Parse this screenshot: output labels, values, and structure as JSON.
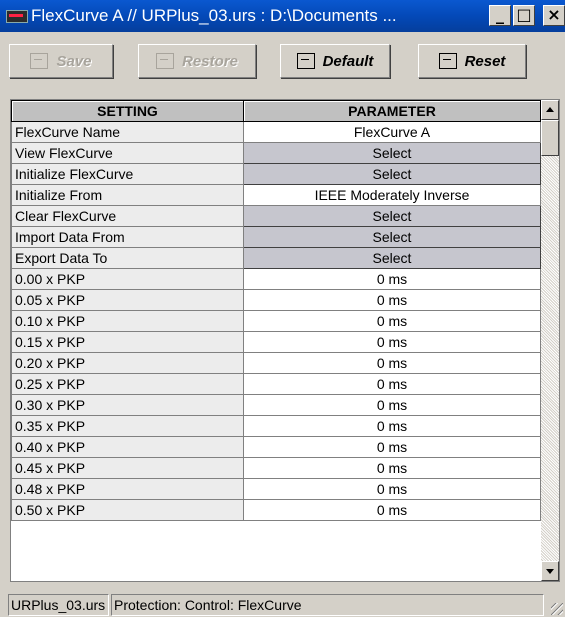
{
  "window": {
    "title": "FlexCurve A // URPlus_03.urs : D:\\Documents ...",
    "minimize": "_",
    "maximize": "□",
    "close": "×"
  },
  "toolbar": {
    "save": "Save",
    "restore": "Restore",
    "default": "Default",
    "reset": "Reset"
  },
  "grid": {
    "headers": [
      "SETTING",
      "PARAMETER"
    ],
    "rows": [
      {
        "setting": "FlexCurve Name",
        "parameter": "FlexCurve A",
        "type": "text"
      },
      {
        "setting": "View FlexCurve",
        "parameter": "Select",
        "type": "button"
      },
      {
        "setting": "Initialize FlexCurve",
        "parameter": "Select",
        "type": "button"
      },
      {
        "setting": "Initialize From",
        "parameter": "IEEE Moderately Inverse",
        "type": "text"
      },
      {
        "setting": "Clear FlexCurve",
        "parameter": "Select",
        "type": "button"
      },
      {
        "setting": "Import Data From",
        "parameter": "Select",
        "type": "button"
      },
      {
        "setting": "Export Data To",
        "parameter": "Select",
        "type": "button"
      },
      {
        "setting": "0.00 x PKP",
        "parameter": "0 ms",
        "type": "text"
      },
      {
        "setting": "0.05 x PKP",
        "parameter": "0 ms",
        "type": "text"
      },
      {
        "setting": "0.10 x PKP",
        "parameter": "0 ms",
        "type": "text"
      },
      {
        "setting": "0.15 x PKP",
        "parameter": "0 ms",
        "type": "text"
      },
      {
        "setting": "0.20 x PKP",
        "parameter": "0 ms",
        "type": "text"
      },
      {
        "setting": "0.25 x PKP",
        "parameter": "0 ms",
        "type": "text"
      },
      {
        "setting": "0.30 x PKP",
        "parameter": "0 ms",
        "type": "text"
      },
      {
        "setting": "0.35 x PKP",
        "parameter": "0 ms",
        "type": "text"
      },
      {
        "setting": "0.40 x PKP",
        "parameter": "0 ms",
        "type": "text"
      },
      {
        "setting": "0.45 x PKP",
        "parameter": "0 ms",
        "type": "text"
      },
      {
        "setting": "0.48 x PKP",
        "parameter": "0 ms",
        "type": "text"
      },
      {
        "setting": "0.50 x PKP",
        "parameter": "0 ms",
        "type": "text"
      }
    ]
  },
  "status": {
    "file": "URPlus_03.urs",
    "path": "Protection: Control: FlexCurve"
  }
}
